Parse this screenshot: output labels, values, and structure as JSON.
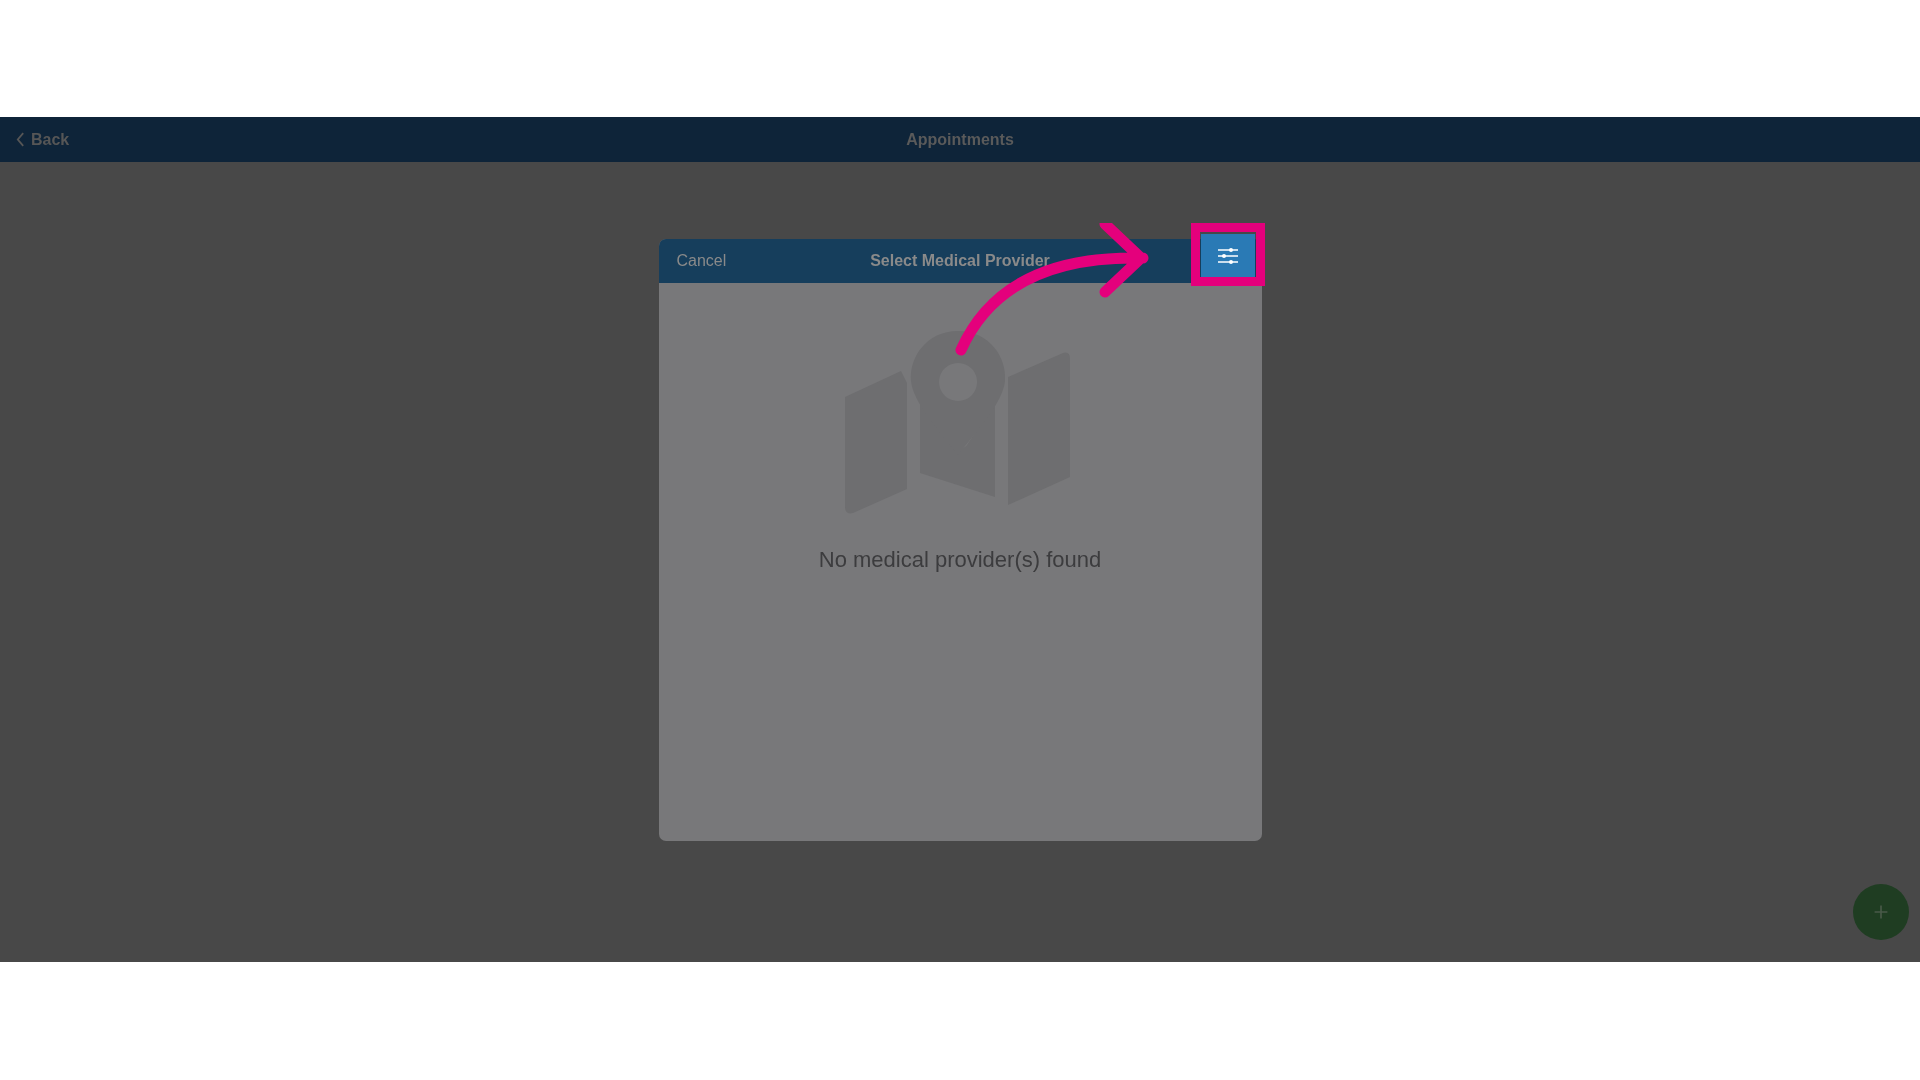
{
  "top_bar": {
    "back_label": "Back",
    "title": "Appointments"
  },
  "dialog": {
    "cancel_label": "Cancel",
    "title": "Select Medical Provider",
    "empty_message": "No medical provider(s) found"
  }
}
